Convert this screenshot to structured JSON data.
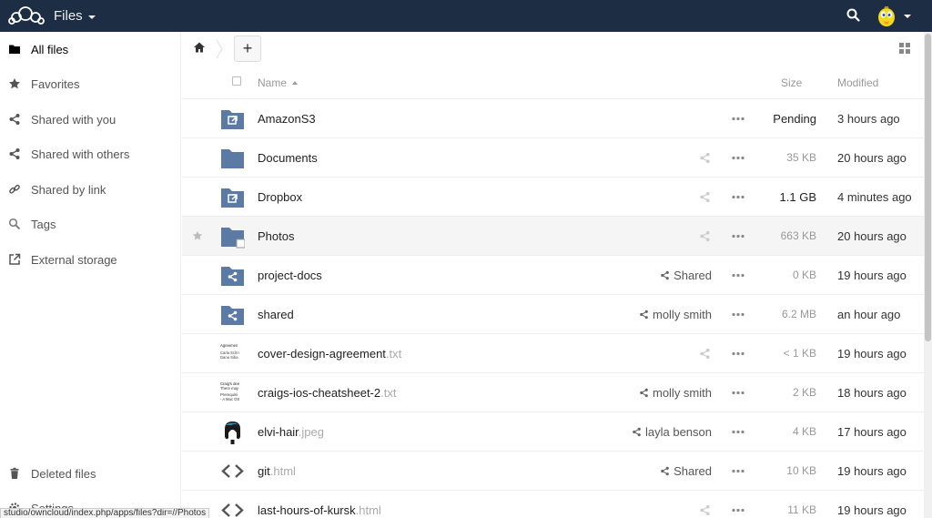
{
  "header": {
    "app_title": "Files",
    "colors": {
      "bar": "#1d2d44",
      "accent": "#5b7ba5"
    }
  },
  "sidebar": {
    "items": [
      {
        "label": "All files",
        "icon": "folder-icon"
      },
      {
        "label": "Favorites",
        "icon": "star-icon"
      },
      {
        "label": "Shared with you",
        "icon": "share-icon"
      },
      {
        "label": "Shared with others",
        "icon": "share-icon"
      },
      {
        "label": "Shared by link",
        "icon": "link-icon"
      },
      {
        "label": "Tags",
        "icon": "search-icon"
      },
      {
        "label": "External storage",
        "icon": "external-link-icon"
      }
    ],
    "bottom": [
      {
        "label": "Deleted files",
        "icon": "trash-icon"
      },
      {
        "label": "Settings",
        "icon": "gear-icon"
      }
    ]
  },
  "status_url": "studio/owncloud/index.php/apps/files?dir=//Photos",
  "toolbar": {
    "new_label": "+"
  },
  "table": {
    "headers": {
      "name": "Name",
      "size": "Size",
      "modified": "Modified"
    },
    "rows": [
      {
        "name": "AmazonS3",
        "ext": "",
        "type": "external-folder",
        "share": "",
        "size": "Pending",
        "modified": "3 hours ago"
      },
      {
        "name": "Documents",
        "ext": "",
        "type": "folder",
        "share": "",
        "size": "35 KB",
        "modified": "20 hours ago"
      },
      {
        "name": "Dropbox",
        "ext": "",
        "type": "external-folder",
        "share": "",
        "size": "1.1 GB",
        "modified": "4 minutes ago"
      },
      {
        "name": "Photos",
        "ext": "",
        "type": "folder",
        "share": "",
        "size": "663 KB",
        "modified": "20 hours ago"
      },
      {
        "name": "project-docs",
        "ext": "",
        "type": "shared-folder",
        "share": "Shared",
        "size": "0 KB",
        "modified": "19 hours ago"
      },
      {
        "name": "shared",
        "ext": "",
        "type": "shared-folder",
        "share": "molly smith",
        "size": "6.2 MB",
        "modified": "an hour ago"
      },
      {
        "name": "cover-design-agreement",
        "ext": ".txt",
        "type": "text-thumb-1",
        "share": "",
        "size": "< 1 KB",
        "modified": "19 hours ago"
      },
      {
        "name": "craigs-ios-cheatsheet-2",
        "ext": ".txt",
        "type": "text-thumb-2",
        "share": "molly smith",
        "size": "2 KB",
        "modified": "18 hours ago"
      },
      {
        "name": "elvi-hair",
        "ext": ".jpeg",
        "type": "image-thumb",
        "share": "layla benson",
        "size": "4 KB",
        "modified": "17 hours ago"
      },
      {
        "name": "git",
        "ext": ".html",
        "type": "code",
        "share": "Shared",
        "size": "10 KB",
        "modified": "19 hours ago"
      },
      {
        "name": "last-hours-of-kursk",
        "ext": ".html",
        "type": "code",
        "share": "",
        "size": "11 KB",
        "modified": "19 hours ago"
      }
    ]
  },
  "thumbs": {
    "t1": [
      "Agreemen",
      "Carla Schn",
      "Dana Siba"
    ],
    "t2": [
      "Craig's dee",
      "There may",
      "Prerequisi",
      "- A Mac OS"
    ]
  }
}
